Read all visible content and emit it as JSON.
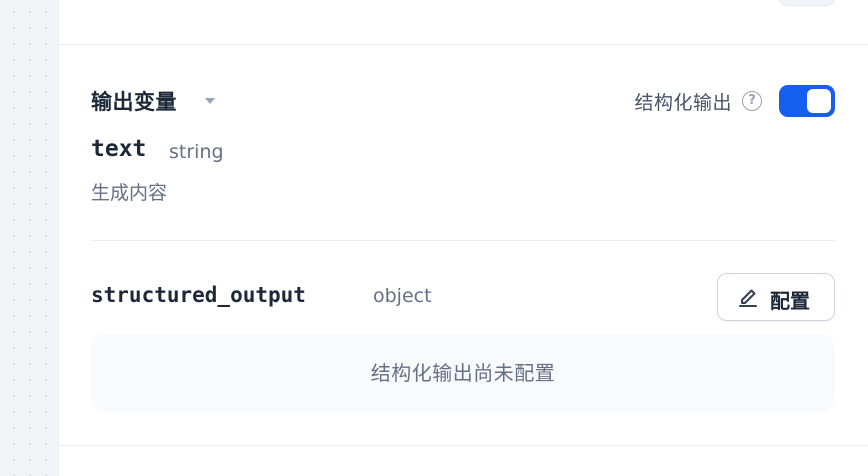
{
  "output_section": {
    "title": "输出变量",
    "structured_label": "结构化输出",
    "help_glyph": "?",
    "structured_enabled": true,
    "accent_color": "#155eef"
  },
  "variables": [
    {
      "name": "text",
      "type": "string",
      "description": "生成内容"
    }
  ],
  "structured_output": {
    "name": "structured_output",
    "type": "object",
    "config_button_label": "配置",
    "empty_message": "结构化输出尚未配置"
  }
}
